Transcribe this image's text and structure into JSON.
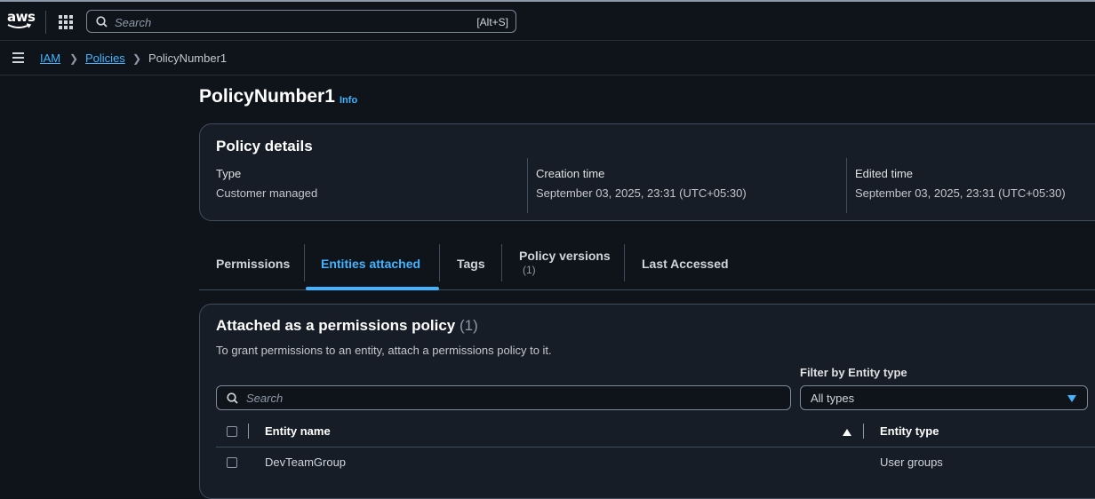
{
  "nav": {
    "logo_text": "aws",
    "search_placeholder": "Search",
    "search_shortcut": "[Alt+S]"
  },
  "breadcrumb": {
    "items": [
      "IAM",
      "Policies",
      "PolicyNumber1"
    ]
  },
  "page": {
    "title": "PolicyNumber1",
    "info": "Info"
  },
  "policy_details": {
    "title": "Policy details",
    "type_label": "Type",
    "type_value": "Customer managed",
    "created_label": "Creation time",
    "created_value": "September 03, 2025, 23:31 (UTC+05:30)",
    "edited_label": "Edited time",
    "edited_value": "September 03, 2025, 23:31 (UTC+05:30)"
  },
  "tabs": [
    {
      "label": "Permissions"
    },
    {
      "label": "Entities attached",
      "active": true
    },
    {
      "label": "Tags"
    },
    {
      "label": "Policy versions",
      "sub": "(1)"
    },
    {
      "label": "Last Accessed"
    }
  ],
  "attached": {
    "title": "Attached as a permissions policy",
    "count": "(1)",
    "description": "To grant permissions to an entity, attach a permissions policy to it.",
    "search_placeholder": "Search",
    "filter_label": "Filter by Entity type",
    "filter_value": "All types",
    "columns": [
      "Entity name",
      "Entity type"
    ],
    "rows": [
      {
        "name": "DevTeamGroup",
        "type": "User groups"
      }
    ]
  },
  "colors": {
    "background": "#0f141a",
    "card": "#161d26",
    "accent": "#42b4ff",
    "border": "#414d5c"
  }
}
